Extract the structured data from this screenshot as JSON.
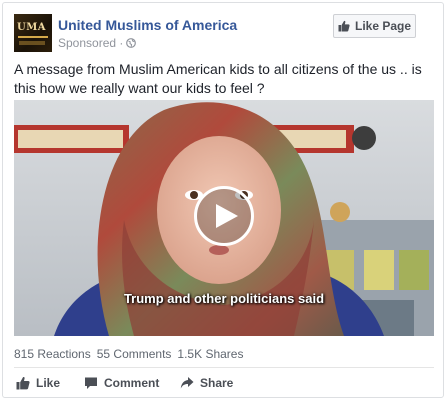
{
  "post": {
    "page_name": "United Muslims of America",
    "sponsored": "Sponsored · ",
    "avatar_icon": "page-logo-icon",
    "like_page_label": "Like Page",
    "message": "A message from Muslim American kids to all citizens of the us .. is this how we really want our kids to feel ?"
  },
  "video": {
    "caption": "Trump and other politicians said",
    "play_icon": "play-icon"
  },
  "stats": {
    "reactions": "815 Reactions",
    "comments": "55 Comments",
    "shares": "1.5K Shares"
  },
  "actions": {
    "like": "Like",
    "comment": "Comment",
    "share": "Share"
  },
  "colors": {
    "link_blue": "#365899",
    "muted_gray": "#90949c",
    "action_gray": "#4b4f56"
  }
}
